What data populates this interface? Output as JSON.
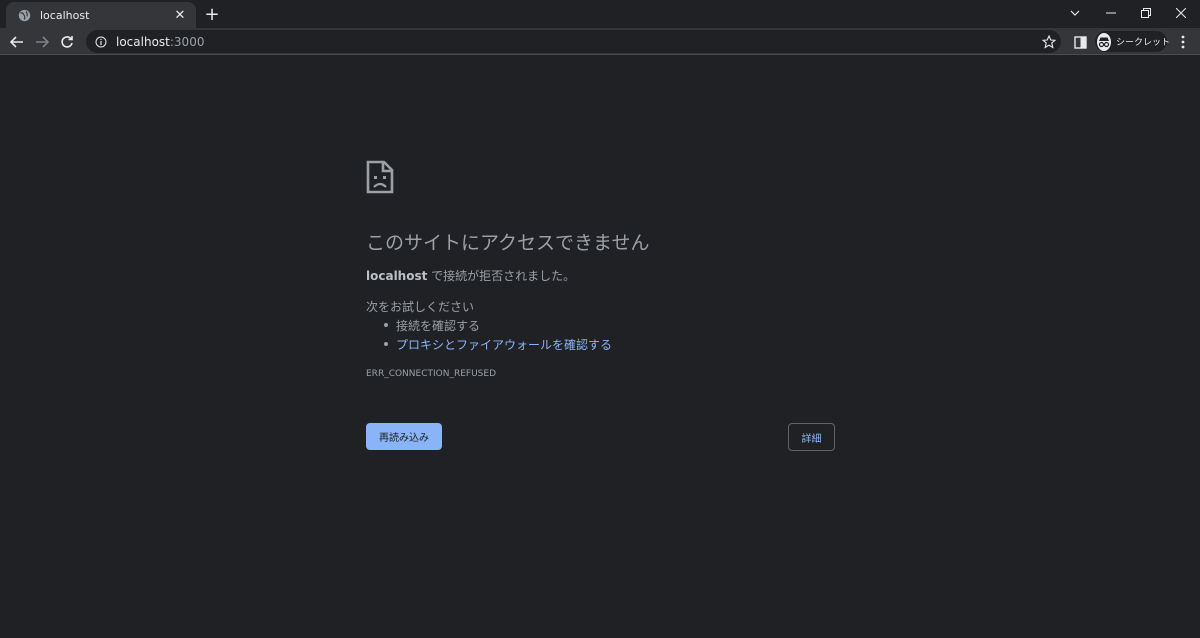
{
  "tab": {
    "title": "localhost",
    "close": "✕"
  },
  "newtab_label": "+",
  "window": {
    "tabsearch": "⌄",
    "minimize": "—",
    "restore": "❐",
    "close": "✕"
  },
  "toolbar": {
    "url_host": "localhost",
    "url_port": ":3000",
    "incognito_label": "シークレット"
  },
  "error": {
    "heading": "このサイトにアクセスできません",
    "host": "localhost",
    "message": " で接続が拒否されました。",
    "try_title": "次をお試しください",
    "suggestions": [
      "接続を確認する",
      "プロキシとファイアウォールを確認する"
    ],
    "code": "ERR_CONNECTION_REFUSED",
    "reload_label": "再読み込み",
    "details_label": "詳細"
  },
  "colors": {
    "bg": "#202124",
    "toolbar": "#35363a",
    "text": "#9aa0a6",
    "accent": "#8ab4f8"
  }
}
